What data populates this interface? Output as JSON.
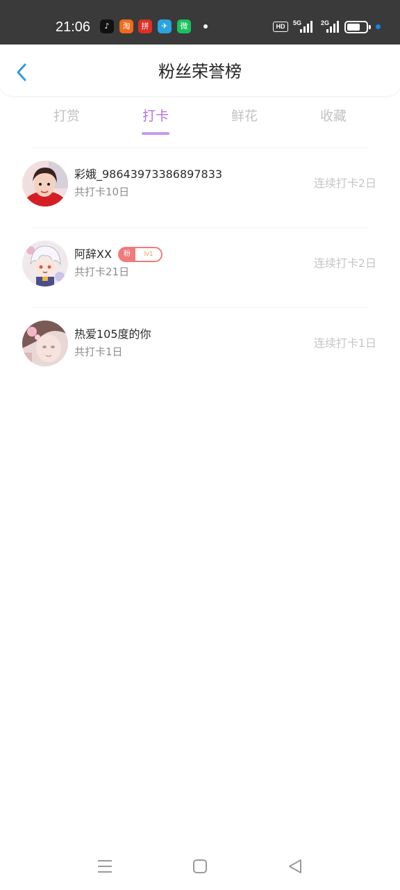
{
  "status_bar": {
    "time": "21:06",
    "hd_label": "HD",
    "signal1_label": "5G",
    "signal2_label": "2G",
    "battery_level": 0.7,
    "apps": [
      {
        "icon": "tiktok-icon",
        "color": "#111111",
        "glyph": "♪"
      },
      {
        "icon": "taobao-icon",
        "color": "#f26a1b",
        "glyph": "淘"
      },
      {
        "icon": "pinduoduo-icon",
        "color": "#e02e24",
        "glyph": "拼"
      },
      {
        "icon": "telegram-icon",
        "color": "#2aa3e0",
        "glyph": "✈"
      },
      {
        "icon": "wechat-mini-icon",
        "color": "#19c15c",
        "glyph": "微"
      }
    ]
  },
  "header": {
    "title": "粉丝荣誉榜"
  },
  "tabs": [
    {
      "label": "打赏",
      "active": false
    },
    {
      "label": "打卡",
      "active": true
    },
    {
      "label": "鲜花",
      "active": false
    },
    {
      "label": "收藏",
      "active": false
    }
  ],
  "fans": [
    {
      "name": "彩娥_98643973386897833",
      "total": "共打卡10日",
      "streak": "连续打卡2日",
      "badge": null
    },
    {
      "name": "阿辞XX",
      "total": "共打卡21日",
      "streak": "连续打卡2日",
      "badge": {
        "left": "粉",
        "level": "lv1"
      }
    },
    {
      "name": "热爱105度的你",
      "total": "共打卡1日",
      "streak": "连续打卡1日",
      "badge": null
    }
  ],
  "colors": {
    "accent": "#b66fe0",
    "tab_underline": "#c49bea",
    "back_arrow": "#2b9be3",
    "badge": "#f07b7b"
  }
}
